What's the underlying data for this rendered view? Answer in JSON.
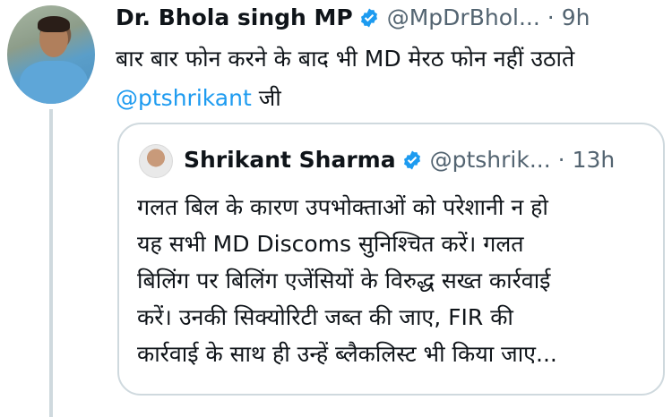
{
  "tweet": {
    "display_name": "Dr. Bhola singh MP",
    "handle": "@MpDrBhol...",
    "separator": "·",
    "time": "9h",
    "text": "बार बार फोन करने के बाद भी MD मेरठ फोन नहीं उठाते",
    "mention": "@ptshrikant",
    "text_after_mention": " जी",
    "verified_icon": "verified-badge",
    "accent_color": "#1d9bf0"
  },
  "quoted_tweet": {
    "display_name": "Shrikant Sharma",
    "handle": "@ptshrik...",
    "separator": "·",
    "time": "13h",
    "lines": [
      "गलत बिल के कारण उपभोक्ताओं को परेशानी न हो",
      "यह सभी MD Discoms सुनिश्चित करें। गलत",
      "बिलिंग पर बिलिंग एजेंसियों के विरुद्ध सख्त कार्रवाई",
      "करें। उनकी सिक्योरिटी जब्त की जाए, FIR की",
      "कार्रवाई के साथ ही उन्हें ब्लैकलिस्ट भी किया जाए..."
    ]
  }
}
